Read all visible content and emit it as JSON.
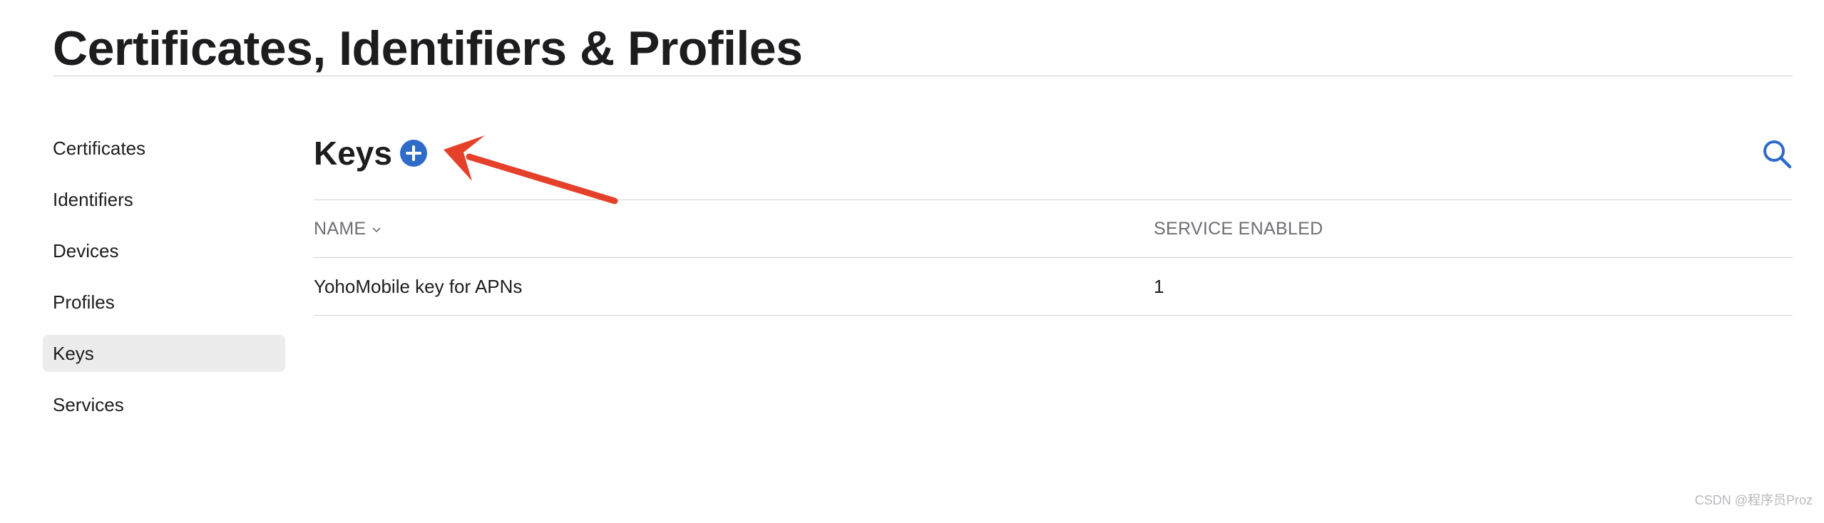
{
  "header": {
    "title": "Certificates, Identifiers & Profiles"
  },
  "sidebar": {
    "items": [
      {
        "label": "Certificates",
        "active": false
      },
      {
        "label": "Identifiers",
        "active": false
      },
      {
        "label": "Devices",
        "active": false
      },
      {
        "label": "Profiles",
        "active": false
      },
      {
        "label": "Keys",
        "active": true
      },
      {
        "label": "Services",
        "active": false
      }
    ]
  },
  "main": {
    "section_title": "Keys",
    "add_icon": "plus-circle-icon",
    "search_icon": "magnifying-glass-icon",
    "table": {
      "columns": [
        "NAME",
        "SERVICE ENABLED"
      ],
      "sort_column": "NAME",
      "sort_icon": "chevron-down-icon",
      "rows": [
        {
          "name": "YohoMobile key for APNs",
          "service_enabled": "1"
        }
      ]
    }
  },
  "annotation": {
    "arrow_icon": "red-arrow-icon",
    "arrow_color": "#e5402a"
  },
  "watermark": {
    "text": "CSDN @程序员Proz"
  },
  "colors": {
    "accent": "#2f6cc9",
    "active_background": "#ececec",
    "divider": "#d2d2d7",
    "muted_text": "#6e6e73"
  }
}
